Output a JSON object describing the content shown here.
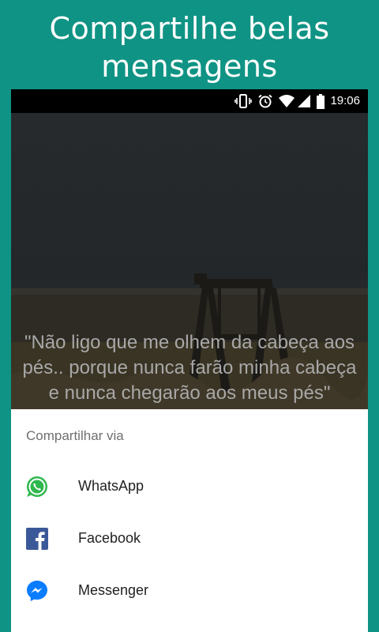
{
  "promo": {
    "title_line1": "Compartilhe belas",
    "title_line2": "mensagens"
  },
  "status_bar": {
    "time": "19:06",
    "icons": [
      "vibrate-icon",
      "alarm-icon",
      "wifi-icon",
      "signal-icon",
      "battery-icon"
    ]
  },
  "quote": {
    "text": "\"Não ligo que me olhem da cabeça aos pés.. porque nunca farão minha cabeça e nunca chegarão aos meus pés\""
  },
  "share_sheet": {
    "title": "Compartilhar via",
    "items": [
      {
        "label": "WhatsApp",
        "icon": "whatsapp-icon",
        "color": "#2fb84e"
      },
      {
        "label": "Facebook",
        "icon": "facebook-icon",
        "color": "#3b5998"
      },
      {
        "label": "Messenger",
        "icon": "messenger-icon",
        "color": "#0a7cff"
      }
    ]
  },
  "colors": {
    "background": "#0f9384",
    "status_bar": "#000000",
    "sheet": "#ffffff"
  }
}
